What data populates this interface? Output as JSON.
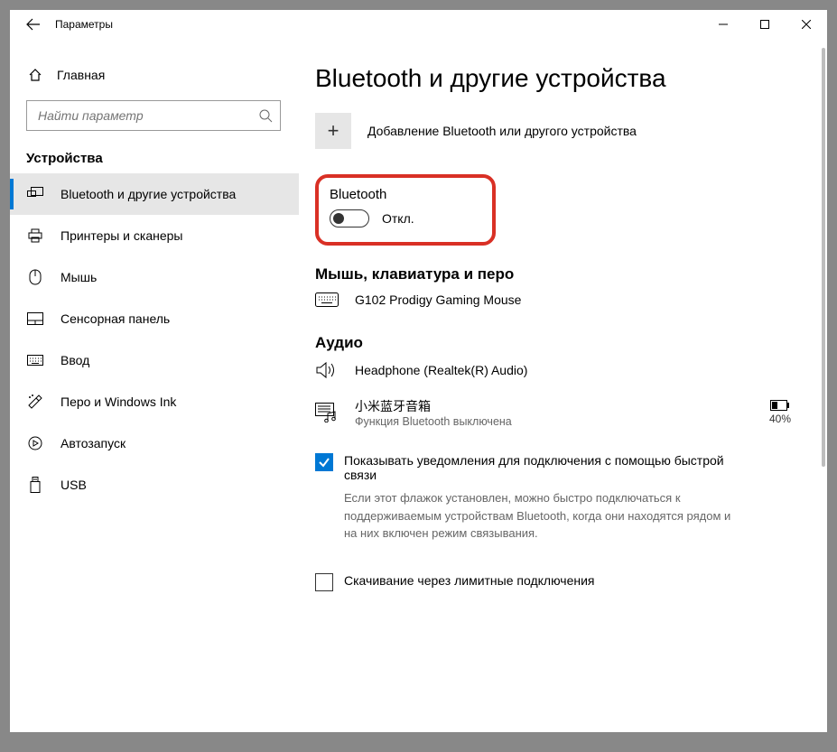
{
  "window": {
    "title": "Параметры"
  },
  "sidebar": {
    "home": "Главная",
    "search_placeholder": "Найти параметр",
    "category": "Устройства",
    "items": [
      {
        "label": "Bluetooth и другие устройства",
        "selected": true
      },
      {
        "label": "Принтеры и сканеры",
        "selected": false
      },
      {
        "label": "Мышь",
        "selected": false
      },
      {
        "label": "Сенсорная панель",
        "selected": false
      },
      {
        "label": "Ввод",
        "selected": false
      },
      {
        "label": "Перо и Windows Ink",
        "selected": false
      },
      {
        "label": "Автозапуск",
        "selected": false
      },
      {
        "label": "USB",
        "selected": false
      }
    ]
  },
  "main": {
    "heading": "Bluetooth и другие устройства",
    "add_device": "Добавление Bluetooth или другого устройства",
    "bluetooth_label": "Bluetooth",
    "bluetooth_state": "Откл.",
    "section_mouse": "Мышь, клавиатура и перо",
    "device_mouse": "G102 Prodigy Gaming Mouse",
    "section_audio": "Аудио",
    "device_headphone": "Headphone (Realtek(R) Audio)",
    "device_speaker_name": "小米蓝牙音箱",
    "device_speaker_sub": "Функция Bluetooth выключена",
    "device_speaker_battery": "40%",
    "chk_swift_label": "Показывать уведомления для подключения с помощью быстрой связи",
    "chk_swift_help": "Если этот флажок установлен, можно быстро подключаться к поддерживаемым устройствам Bluetooth, когда они находятся рядом и на них включен режим связывания.",
    "chk_metered_label": "Скачивание через лимитные подключения"
  }
}
